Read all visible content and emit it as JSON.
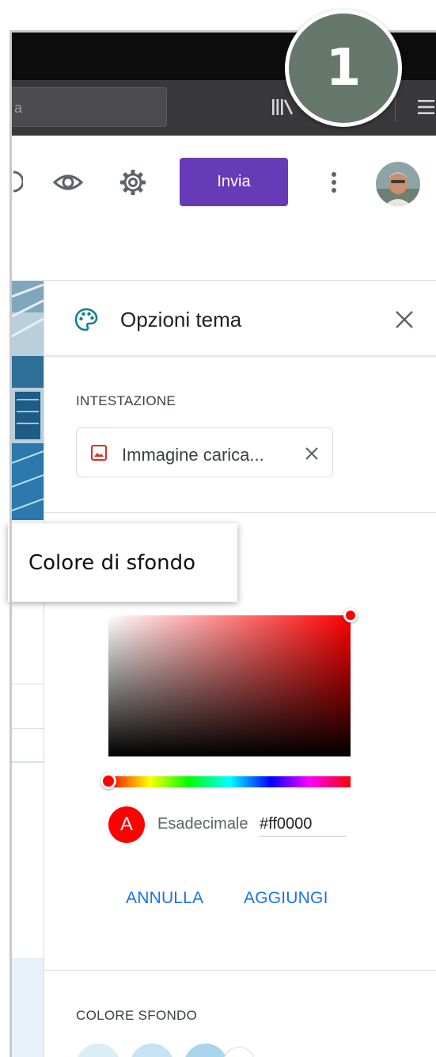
{
  "annotation": {
    "step_number": "1"
  },
  "browser": {
    "url_fragment": "a",
    "toolbar_icons": [
      "library-icon",
      "hamburger-menu-icon"
    ]
  },
  "forms_header": {
    "icons": [
      "preview-eye-icon",
      "settings-gear-icon",
      "more-vert-icon"
    ],
    "send_label": "Invia"
  },
  "theme_panel": {
    "title": "Opzioni tema",
    "header_section": {
      "label": "INTESTAZIONE",
      "chip_text": "Immagine carica..."
    },
    "tooltip": "Colore di sfondo",
    "color_picker": {
      "selected_color": "#ff0000",
      "preview_letter": "A",
      "hex_label": "Esadecimale",
      "hex_value": "#ff0000",
      "cancel_label": "ANNULLA",
      "add_label": "AGGIUNGI"
    },
    "background_section": {
      "label": "COLORE SFONDO",
      "swatches": [
        "#dbeef7",
        "#c5e3f2",
        "#a9d6ec",
        "#f1f3f4"
      ]
    }
  },
  "colors": {
    "brand_purple": "#673ab7",
    "badge_green": "#66786c",
    "link_blue": "#1a73e8"
  }
}
